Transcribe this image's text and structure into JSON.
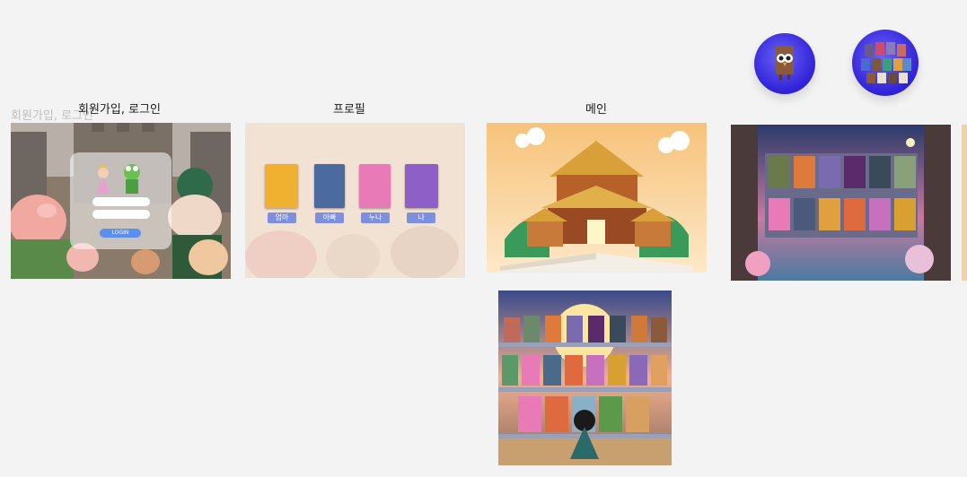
{
  "sections": {
    "signup_login": "회원가입, 로그인",
    "profile": "프로필",
    "main": "메인"
  },
  "ghost_label": "회원가입, 로그인",
  "login_card": {
    "button": "LOGIN"
  },
  "profiles": [
    {
      "name": "엄마",
      "color": "#f0b030"
    },
    {
      "name": "아빠",
      "color": "#4a6aa0"
    },
    {
      "name": "누나",
      "color": "#e87ab8"
    },
    {
      "name": "나",
      "color": "#8f5fc8"
    }
  ],
  "colors": {
    "avatar_bg": "#3a2fe0",
    "chip": "#7f8fe0",
    "page_bg": "#f3f3f3"
  }
}
